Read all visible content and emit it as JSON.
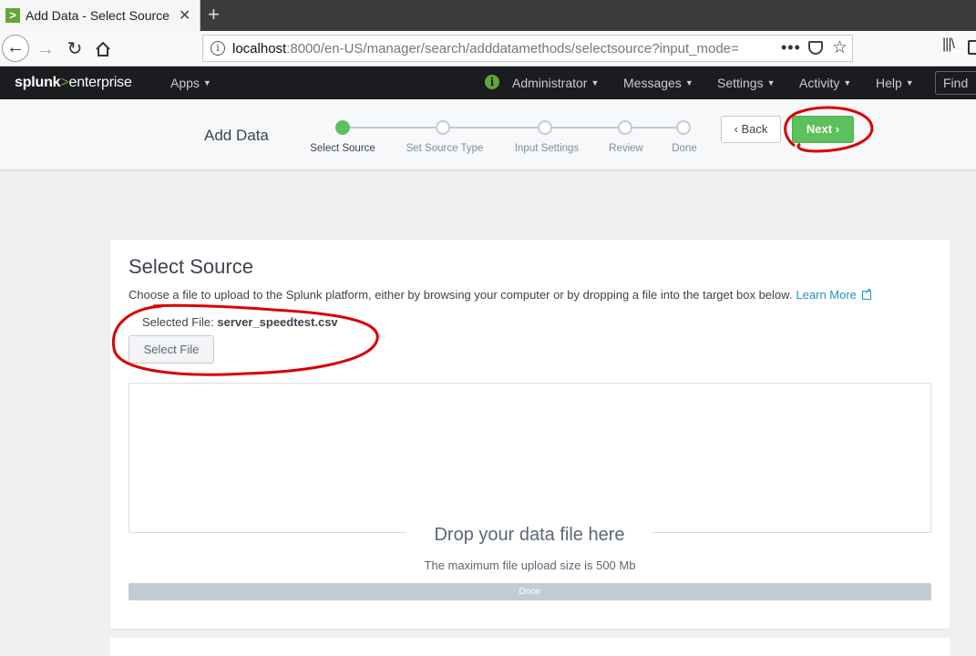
{
  "browser": {
    "tab_title": "Add Data - Select Source",
    "favicon_glyph": ">",
    "url_host": "localhost",
    "url_rest": ":8000/en-US/manager/search/adddatamethods/selectsource?input_mode=",
    "url_more": "•••"
  },
  "splunk": {
    "logo_prefix": "splunk",
    "logo_chevron": ">",
    "logo_suffix": "enterprise",
    "menu": {
      "apps": "Apps",
      "administrator": "Administrator",
      "messages": "Messages",
      "settings": "Settings",
      "activity": "Activity",
      "help": "Help",
      "find": "Find"
    },
    "colors": {
      "brand_green": "#65a637",
      "header_bg": "#1a1c20"
    }
  },
  "wizard": {
    "title": "Add Data",
    "steps": [
      {
        "label": "Select Source",
        "active": true
      },
      {
        "label": "Set Source Type",
        "active": false
      },
      {
        "label": "Input Settings",
        "active": false
      },
      {
        "label": "Review",
        "active": false
      },
      {
        "label": "Done",
        "active": false
      }
    ],
    "back_label": "Back",
    "next_label": "Next",
    "colors": {
      "active_step": "#5cc05c",
      "next_button": "#5cc05c"
    }
  },
  "main": {
    "title": "Select Source",
    "description": "Choose a file to upload to the Splunk platform, either by browsing your computer or by dropping a file into the target box below.",
    "learn_more": "Learn More",
    "selected_file_label": "Selected File:",
    "selected_file_value": "server_speedtest.csv",
    "select_file_button": "Select File",
    "drop_title": "Drop your data file here",
    "drop_subtitle": "The maximum file upload size is 500 Mb",
    "progress_label": "Done"
  }
}
